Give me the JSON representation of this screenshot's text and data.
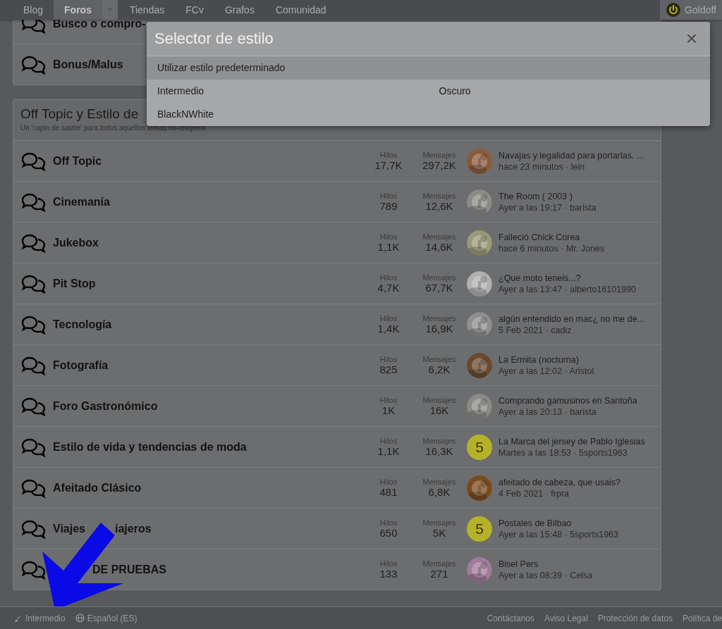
{
  "nav": {
    "items": [
      {
        "label": "Blog",
        "selected": false
      },
      {
        "label": "Foros",
        "selected": true,
        "dropdown": true
      },
      {
        "label": "Tiendas",
        "selected": false
      },
      {
        "label": "FCv",
        "selected": false
      },
      {
        "label": "Grafos",
        "selected": false
      },
      {
        "label": "Comunidad",
        "selected": false
      }
    ],
    "user": "Goldoff"
  },
  "top_card": {
    "rows": [
      {
        "title": "Busco o compro-"
      },
      {
        "title": "Bonus/Malus"
      }
    ]
  },
  "section": {
    "title": "Off Topic y Estilo de",
    "subtitle": "Un 'cajón de sastre' para todos aquellos temas no-relojeros",
    "rows": [
      {
        "title": "Off Topic",
        "threads_label": "Hilos",
        "threads": "17,7K",
        "messages_label": "Mensajes",
        "messages": "297,2K",
        "last_title": "Navajas y legalidad para portarlas. ...",
        "last_meta": "hace 23 minutos · lein"
      },
      {
        "title": "Cinemanía",
        "threads_label": "Hilos",
        "threads": "789",
        "messages_label": "Mensajes",
        "messages": "12,6K",
        "last_title": "The Room ( 2003 )",
        "last_meta": "Ayer a las 19:17 · barista"
      },
      {
        "title": "Jukebox",
        "threads_label": "Hilos",
        "threads": "1,1K",
        "messages_label": "Mensajes",
        "messages": "14,6K",
        "last_title": "Falleció Chick Corea",
        "last_meta": "hace 6 minutos · Mr. Jones"
      },
      {
        "title": "Pit Stop",
        "threads_label": "Hilos",
        "threads": "4,7K",
        "messages_label": "Mensajes",
        "messages": "67,7K",
        "last_title": "¿Que moto teneis...?",
        "last_meta": "Ayer a las 13:47 · alberto16101990"
      },
      {
        "title": "Tecnología",
        "threads_label": "Hilos",
        "threads": "1,4K",
        "messages_label": "Mensajes",
        "messages": "16,9K",
        "last_title": "algún entendido en mac¿ no me de...",
        "last_meta": "5 Feb 2021 · cadiz"
      },
      {
        "title": "Fotografía",
        "threads_label": "Hilos",
        "threads": "825",
        "messages_label": "Mensajes",
        "messages": "6,2K",
        "last_title": "La Ermita (nocturna)",
        "last_meta": "Ayer a las 12:02 · Aristol"
      },
      {
        "title": "Foro Gastronómico",
        "threads_label": "Hilos",
        "threads": "1K",
        "messages_label": "Mensajes",
        "messages": "16K",
        "last_title": "Comprando gamusinos en Santoña",
        "last_meta": "Ayer a las 20:13 · barista"
      },
      {
        "title": "Estilo de vida y tendencias de moda",
        "threads_label": "Hilos",
        "threads": "1,1K",
        "messages_label": "Mensajes",
        "messages": "16,3K",
        "avatar": {
          "kind": "letter",
          "letter": "5",
          "color": "#b5b22a"
        },
        "last_title": "La Marca del jersey de Pablo Iglesias",
        "last_meta": "Martes a las 18:53 · 5sports1963"
      },
      {
        "title": "Afeitado Clásico",
        "threads_label": "Hilos",
        "threads": "481",
        "messages_label": "Mensajes",
        "messages": "6,8K",
        "last_title": "afeitado de cabeza, que usais?",
        "last_meta": "4 Feb 2021 · frpra"
      },
      {
        "title": "Viajes",
        "title_tail": "iajeros",
        "threads_label": "Hilos",
        "threads": "650",
        "messages_label": "Mensajes",
        "messages": "5K",
        "avatar": {
          "kind": "letter",
          "letter": "5",
          "color": "#b5b22a"
        },
        "last_title": "Postales de Bilbao",
        "last_meta": "Ayer a las 15:48 · 5sports1963"
      },
      {
        "title_tail": "DE PRUEBAS",
        "threads_label": "Hilos",
        "threads": "133",
        "messages_label": "Mensajes",
        "messages": "271",
        "last_title": "Bisel Pers",
        "last_meta": "Ayer a las 08:39 · Celsa"
      }
    ]
  },
  "modal": {
    "title": "Selector de estilo",
    "close": "×",
    "default_option": {
      "label": "Utilizar estilo predeterminado",
      "selected": true
    },
    "options": [
      {
        "label": "Intermedio",
        "selected": false
      },
      {
        "label": "Oscuro",
        "selected": false
      },
      {
        "label": "BlackNWhite",
        "selected": false
      }
    ]
  },
  "footer": {
    "style": "Intermedio",
    "language": "Español (ES)",
    "links": [
      "Contáctanos",
      "Aviso Legal",
      "Protección de datos",
      "Política de"
    ]
  }
}
